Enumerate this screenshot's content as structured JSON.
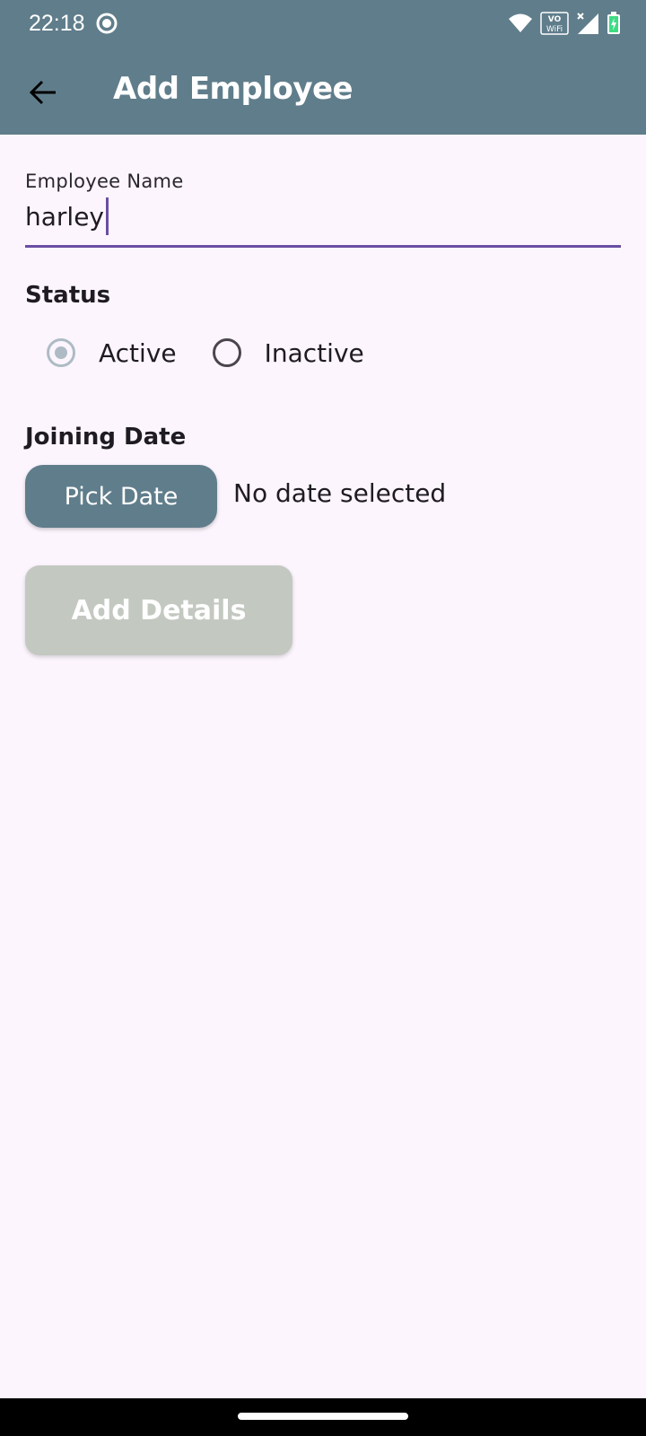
{
  "status_bar": {
    "time": "22:18",
    "icons": [
      "record-icon",
      "wifi-icon",
      "vowifi-icon",
      "signal-icon",
      "battery-icon"
    ],
    "vowifi_top": "VO",
    "vowifi_bottom": "WiFi"
  },
  "app_bar": {
    "title": "Add Employee",
    "back_icon": "arrow-back-icon",
    "background": "#607d8b"
  },
  "form": {
    "name_label": "Employee Name",
    "name_value": "harley",
    "status_label": "Status",
    "status_options": [
      {
        "label": "Active",
        "selected": true
      },
      {
        "label": "Inactive",
        "selected": false
      }
    ],
    "joining_label": "Joining Date",
    "pick_date_label": "Pick Date",
    "date_text": "No date selected",
    "submit_label": "Add Details"
  },
  "colors": {
    "accent": "#6a4fa3",
    "primary": "#607d8b",
    "disabled_button": "#c3c8c1",
    "background": "#fcf5fd"
  }
}
